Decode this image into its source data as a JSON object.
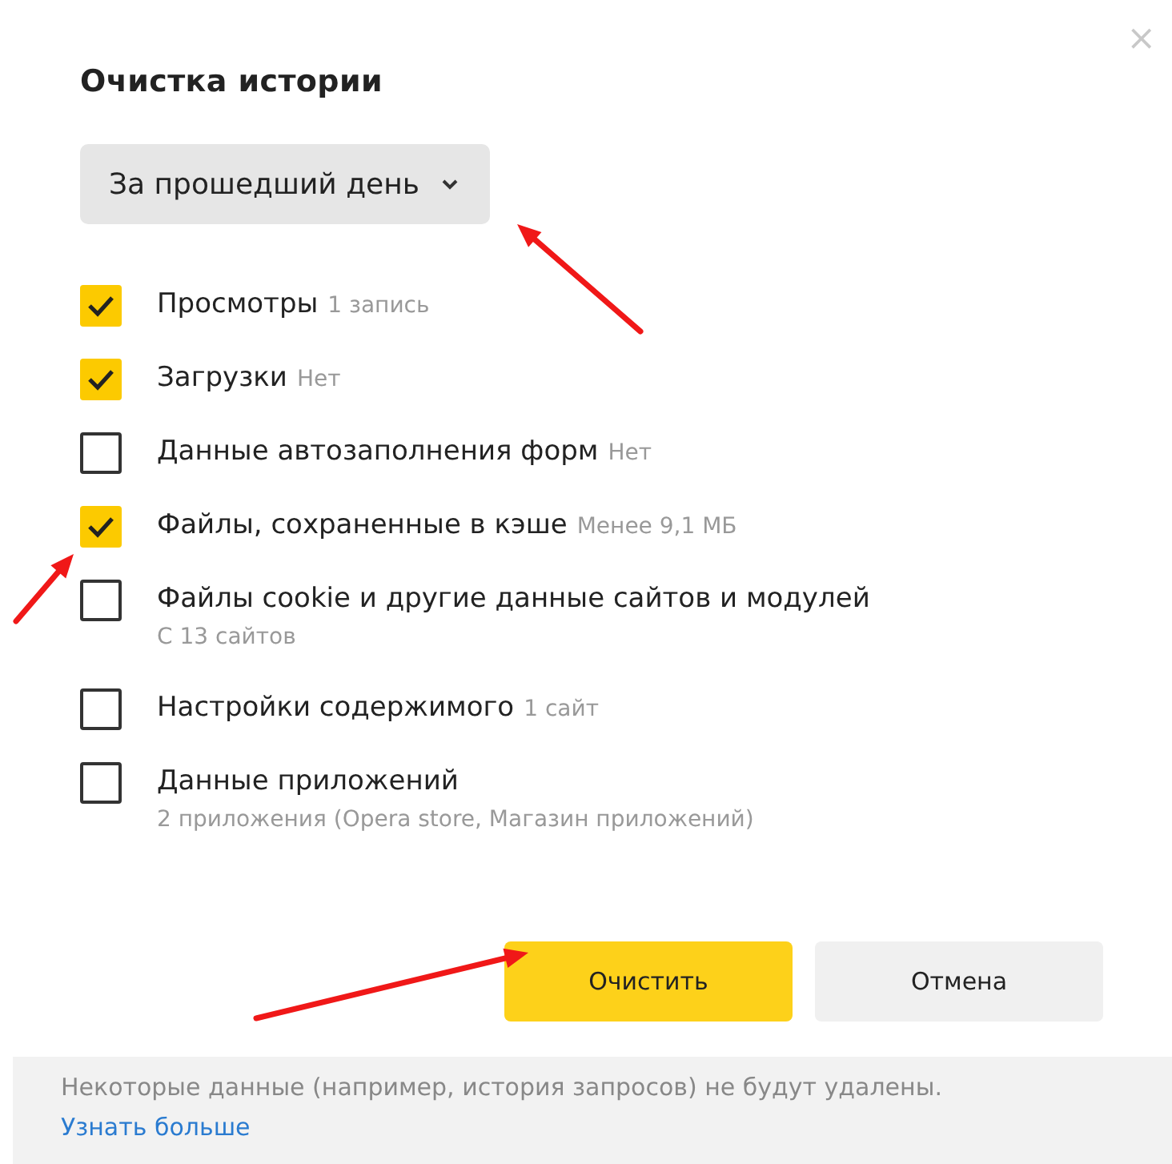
{
  "dialog": {
    "title": "Очистка истории",
    "close": "×"
  },
  "period": {
    "value": "За прошедший день"
  },
  "items": [
    {
      "label": "Просмотры",
      "detail": "1 запись",
      "checked": true
    },
    {
      "label": "Загрузки",
      "detail": "Нет",
      "checked": true
    },
    {
      "label": "Данные автозаполнения форм",
      "detail": "Нет",
      "checked": false
    },
    {
      "label": "Файлы, сохраненные в кэше",
      "detail": "Менее 9,1 МБ",
      "checked": true
    },
    {
      "label": "Файлы cookie и другие данные сайтов и модулей",
      "subdetail": "С 13 сайтов",
      "checked": false
    },
    {
      "label": "Настройки содержимого",
      "detail": "1 сайт",
      "checked": false
    },
    {
      "label": "Данные приложений",
      "subdetail": "2 приложения (Opera store, Магазин приложений)",
      "checked": false
    }
  ],
  "buttons": [
    {
      "label": "Очистить",
      "kind": "primary"
    },
    {
      "label": "Отмена",
      "kind": "secondary"
    }
  ],
  "footer": {
    "note": "Некоторые данные (например, история запросов) не будут удалены.",
    "link": "Узнать больше"
  }
}
